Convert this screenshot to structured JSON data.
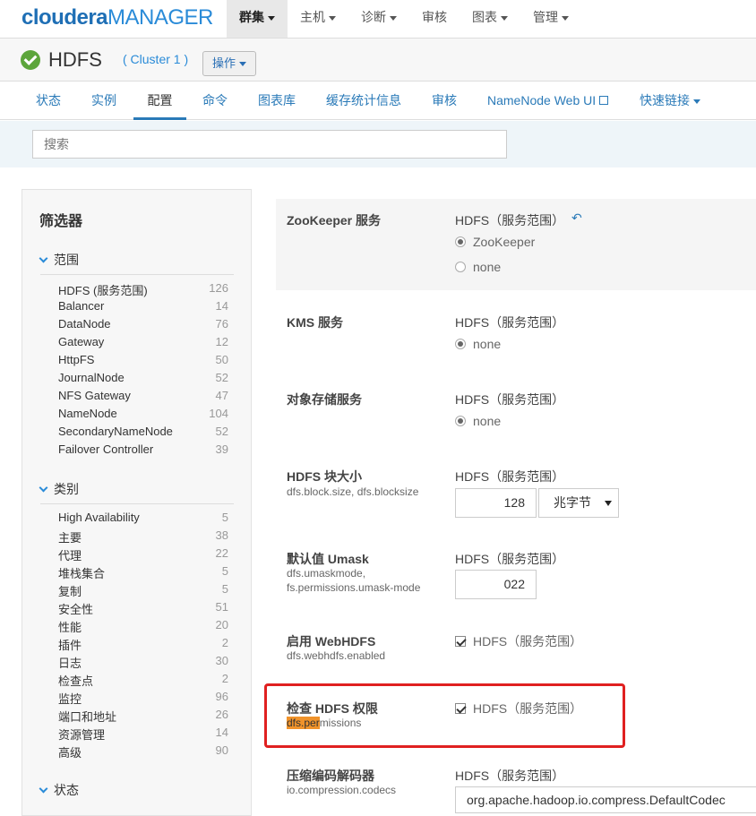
{
  "logo": {
    "part1": "cloudera",
    "part2": "MANAGER"
  },
  "topnav": [
    {
      "label": "群集",
      "caret": true,
      "active": true
    },
    {
      "label": "主机",
      "caret": true,
      "active": false
    },
    {
      "label": "诊断",
      "caret": true,
      "active": false
    },
    {
      "label": "审核",
      "caret": false,
      "active": false
    },
    {
      "label": "图表",
      "caret": true,
      "active": false
    },
    {
      "label": "管理",
      "caret": true,
      "active": false
    }
  ],
  "service": {
    "name": "HDFS",
    "cluster": "( Cluster 1 )",
    "ops_label": "操作",
    "status_color": "#5ca53b"
  },
  "tabs": [
    {
      "label": "状态"
    },
    {
      "label": "实例"
    },
    {
      "label": "配置"
    },
    {
      "label": "命令"
    },
    {
      "label": "图表库"
    },
    {
      "label": "缓存统计信息"
    },
    {
      "label": "审核"
    },
    {
      "label": "NameNode Web UI"
    },
    {
      "label": "快速链接"
    }
  ],
  "search": {
    "placeholder": "搜索"
  },
  "filter": {
    "title": "筛选器",
    "scope_heading": "范围",
    "scope": [
      {
        "name": "HDFS (服务范围)",
        "count": "126"
      },
      {
        "name": "Balancer",
        "count": "14"
      },
      {
        "name": "DataNode",
        "count": "76"
      },
      {
        "name": "Gateway",
        "count": "12"
      },
      {
        "name": "HttpFS",
        "count": "50"
      },
      {
        "name": "JournalNode",
        "count": "52"
      },
      {
        "name": "NFS Gateway",
        "count": "47"
      },
      {
        "name": "NameNode",
        "count": "104"
      },
      {
        "name": "SecondaryNameNode",
        "count": "52"
      },
      {
        "name": "Failover Controller",
        "count": "39"
      }
    ],
    "category_heading": "类别",
    "category": [
      {
        "name": "High Availability",
        "count": "5"
      },
      {
        "name": "主要",
        "count": "38"
      },
      {
        "name": "代理",
        "count": "22"
      },
      {
        "name": "堆栈集合",
        "count": "5"
      },
      {
        "name": "复制",
        "count": "5"
      },
      {
        "name": "安全性",
        "count": "51"
      },
      {
        "name": "性能",
        "count": "20"
      },
      {
        "name": "插件",
        "count": "2"
      },
      {
        "name": "日志",
        "count": "30"
      },
      {
        "name": "检查点",
        "count": "2"
      },
      {
        "name": "监控",
        "count": "96"
      },
      {
        "name": "端口和地址",
        "count": "26"
      },
      {
        "name": "资源管理",
        "count": "14"
      },
      {
        "name": "高级",
        "count": "90"
      }
    ],
    "state_heading": "状态"
  },
  "config": {
    "zk": {
      "label": "ZooKeeper 服务",
      "scope": "HDFS（服务范围）",
      "opt1": "ZooKeeper",
      "opt2": "none"
    },
    "kms": {
      "label": "KMS 服务",
      "scope": "HDFS（服务范围）",
      "opt1": "none"
    },
    "obj": {
      "label": "对象存储服务",
      "scope": "HDFS（服务范围）",
      "opt1": "none"
    },
    "blocksize": {
      "label": "HDFS 块大小",
      "key": "dfs.block.size, dfs.blocksize",
      "scope": "HDFS（服务范围）",
      "value": "128",
      "unit": "兆字节"
    },
    "umask": {
      "label": "默认值 Umask",
      "key": "dfs.umaskmode, fs.permissions.umask-mode",
      "scope": "HDFS（服务范围）",
      "value": "022"
    },
    "webhdfs": {
      "label": "启用 WebHDFS",
      "key": "dfs.webhdfs.enabled",
      "scope": "HDFS（服务范围）"
    },
    "perm": {
      "label": "检查 HDFS 权限",
      "key_hl": "dfs.per",
      "key_rest": "missions",
      "scope": "HDFS（服务范围）"
    },
    "codec": {
      "label": "压缩编码解码器",
      "key": "io.compression.codecs",
      "scope": "HDFS（服务范围）",
      "value": "org.apache.hadoop.io.compress.DefaultCodec"
    }
  }
}
